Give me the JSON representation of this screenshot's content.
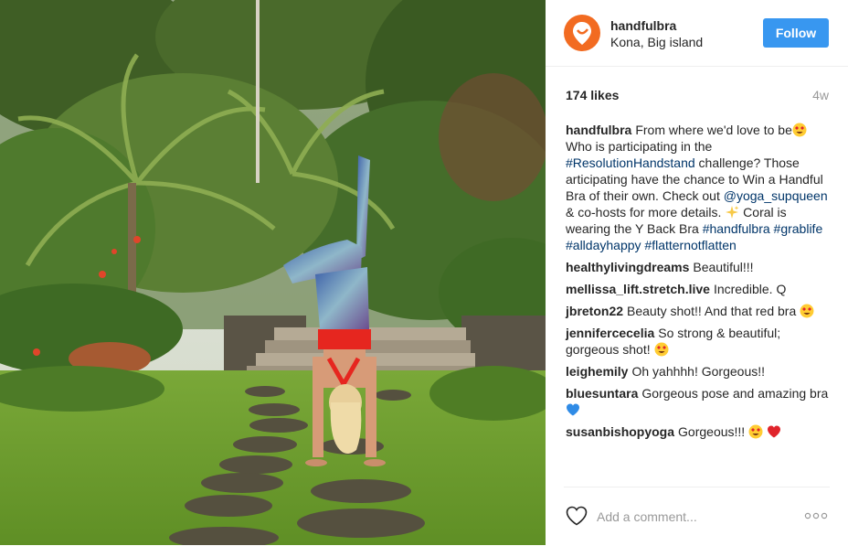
{
  "post": {
    "username": "handfulbra",
    "location": "Kona, Big island",
    "follow_label": "Follow",
    "likes": "174 likes",
    "age": "4w",
    "avatar_color": "#f26b21",
    "follow_color": "#3897f0",
    "link_color": "#003569"
  },
  "caption": {
    "author": "handfulbra",
    "text1": "From where we'd love to be",
    "text2": " Who is participating in the ",
    "hashtag1": "#ResolutionHandstand",
    "text3": " challenge? Those articipating have the chance to Win a Handful Bra of their own. Check out ",
    "mention": "@yoga_supqueen",
    "text4": " & co-hosts for more details. ",
    "text5": " Coral is wearing the Y Back Bra ",
    "hashtags": [
      "#handfulbra",
      "#grablife",
      "#alldayhappy",
      "#flatternotflatten"
    ],
    "emoji": [
      "heart-eyes-emoji",
      "sparkles-emoji"
    ]
  },
  "comments": [
    {
      "author": "healthylivingdreams",
      "text": "Beautiful!!!",
      "emoji": []
    },
    {
      "author": "mellissa_lift.stretch.live",
      "text": "Incredible. Q",
      "emoji": []
    },
    {
      "author": "jbreton22",
      "text": "Beauty shot!! And that red bra",
      "emoji": [
        "heart-eyes-emoji"
      ]
    },
    {
      "author": "jennifercecelia",
      "text": "So strong & beautiful; gorgeous shot!",
      "emoji": [
        "heart-eyes-emoji"
      ]
    },
    {
      "author": "leighemily",
      "text": "Oh yahhhh! Gorgeous!!",
      "emoji": []
    },
    {
      "author": "bluesuntara",
      "text": "Gorgeous pose and amazing bra",
      "emoji": [
        "blue-heart-emoji"
      ]
    },
    {
      "author": "susanbishopyoga",
      "text": "Gorgeous!!!",
      "emoji": [
        "heart-eyes-emoji",
        "red-heart-emoji"
      ]
    }
  ],
  "footer": {
    "comment_placeholder": "Add a comment...",
    "like_icon": "heart-outline-icon",
    "more_icon": "ellipsis-icon"
  }
}
